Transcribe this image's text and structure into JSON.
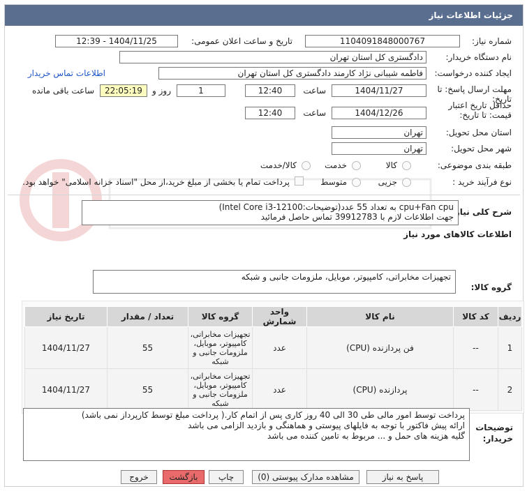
{
  "window": {
    "title": "جزئیات اطلاعات نیاز"
  },
  "labels": {
    "need_number": "شماره نیاز:",
    "announce_datetime": "تاریخ و ساعت اعلان عمومی:",
    "buyer_org": "نام دستگاه خریدار:",
    "requester": "ایجاد کننده درخواست:",
    "reply_deadline": "مهلت ارسال پاسخ: تا تاریخ:",
    "min_price_validity": "حداقل تاریخ اعتبار قیمت: تا تاریخ:",
    "hour": "ساعت",
    "day_and": "روز و",
    "remaining": "ساعت باقی مانده",
    "delivery_province": "استان محل تحویل:",
    "delivery_city": "شهر محل تحویل:",
    "category": "طبقه بندی موضوعی:",
    "purchase_process": "نوع فرآیند خرید :",
    "general_desc": "شرح کلی نیاز:",
    "goods_info": "اطلاعات کالاهای مورد نیاز",
    "goods_group": "گروه کالا:",
    "buyer_notes": "توضیحات خریدار:"
  },
  "fields": {
    "need_number": "1104091848000767",
    "announce_datetime": "1404/11/25 - 12:39",
    "buyer_org": "دادگستری کل استان تهران",
    "requester": "فاطمه شیبانی نژاد کارمند دادگستری کل استان تهران",
    "buyer_contact_link": "اطلاعات تماس خریدار",
    "reply_date": "1404/11/27",
    "reply_time": "12:40",
    "reply_days": "1",
    "remaining_time": "22:05:19",
    "validity_date": "1404/12/26",
    "validity_time": "12:40",
    "province": "تهران",
    "city": "تهران",
    "goods_group": "تجهیزات مخابراتی، کامپیوتر، موبایل، ملزومات جانبی و شبکه"
  },
  "category_options": [
    "کالا",
    "خدمت",
    "کالا/خدمت"
  ],
  "process_options": [
    "جزیی",
    "متوسط"
  ],
  "process_note": "پرداخت تمام یا بخشی از مبلغ خرید،از محل \"اسناد خزانه اسلامی\" خواهد بود.",
  "general_description": {
    "line1": "cpu+Fan cpu  به تعداد 55 عدد(توضیحات:Intel Core i3-12100)",
    "line2": "جهت اطلاعات لازم با  39912783  تماس حاصل فرمائید"
  },
  "table": {
    "headers": [
      "ردیف",
      "کد کالا",
      "نام کالا",
      "واحد شمارش",
      "گروه کالا",
      "تعداد / مقدار",
      "تاریخ نیاز"
    ],
    "rows": [
      {
        "index": "1",
        "code": "--",
        "name": "فن پردازنده (CPU)",
        "unit": "عدد",
        "group": "تجهیزات مخابراتی، کامپیوتر، موبایل، ملزومات جانبی و شبکه",
        "qty": "55",
        "date": "1404/11/27"
      },
      {
        "index": "2",
        "code": "--",
        "name": "پردازنده (CPU)",
        "unit": "عدد",
        "group": "تجهیزات مخابراتی، کامپیوتر، موبایل، ملزومات جانبی و شبکه",
        "qty": "55",
        "date": "1404/11/27"
      }
    ]
  },
  "buyer_notes": {
    "line1": "پرداخت توسط امور مالی طی 30 الی 40 روز کاری پس از اتمام کار.( پرداخت مبلغ توسط کارپرداز نمی باشد)",
    "line2": "ارائه پیش فاکتور با توجه به فایلهای پیوستی و هماهنگی و بازدید الزامی می باشد",
    "line3": "گلیه هزینه های حمل و ... مربوط به تامین کننده می باشد"
  },
  "buttons": {
    "reply": "پاسخ به نیاز",
    "attachments": "مشاهده مدارک پیوستی (0)",
    "print": "چاپ",
    "back": "بازگشت",
    "exit": "خروج"
  },
  "colors": {
    "titlebar": "#5a6f8f",
    "highlight": "#ffffbf",
    "link": "#1f55c8",
    "red_button": "#e86a6a"
  }
}
